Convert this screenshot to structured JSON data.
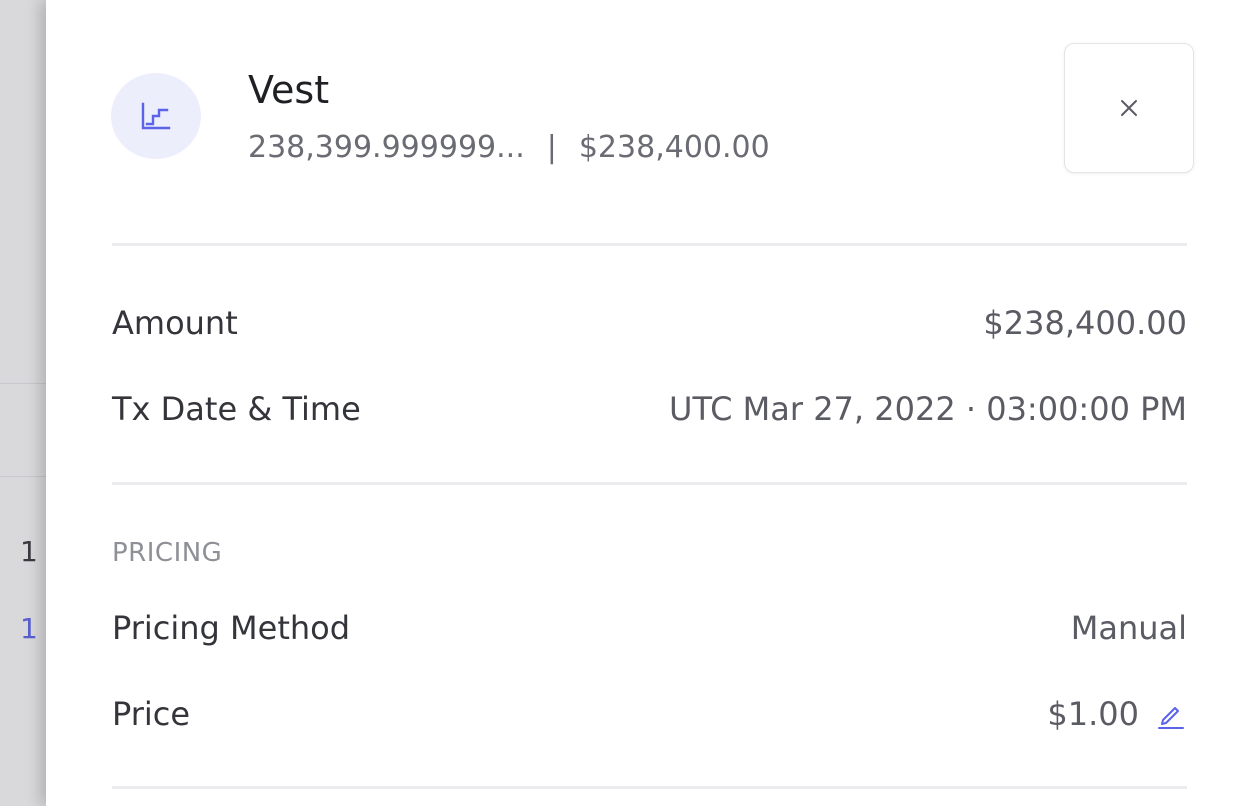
{
  "backdrop": {
    "row1_fragment": "1",
    "row2_fragment": "1"
  },
  "header": {
    "icon": "vest-stairs-icon",
    "title": "Vest",
    "quantity": "238,399.999999...",
    "separator": "|",
    "value": "$238,400.00",
    "close_icon": "close-icon"
  },
  "details": {
    "amount_label": "Amount",
    "amount_value": "$238,400.00",
    "datetime_label": "Tx Date & Time",
    "datetime_value": "UTC Mar 27, 2022 · 03:00:00 PM"
  },
  "pricing": {
    "section_label": "PRICING",
    "method_label": "Pricing Method",
    "method_value": "Manual",
    "price_label": "Price",
    "price_value": "$1.00",
    "edit_icon": "pencil-icon"
  },
  "colors": {
    "accent": "#5b63e8",
    "icon_bg": "#eceefb",
    "divider": "#ececef"
  }
}
